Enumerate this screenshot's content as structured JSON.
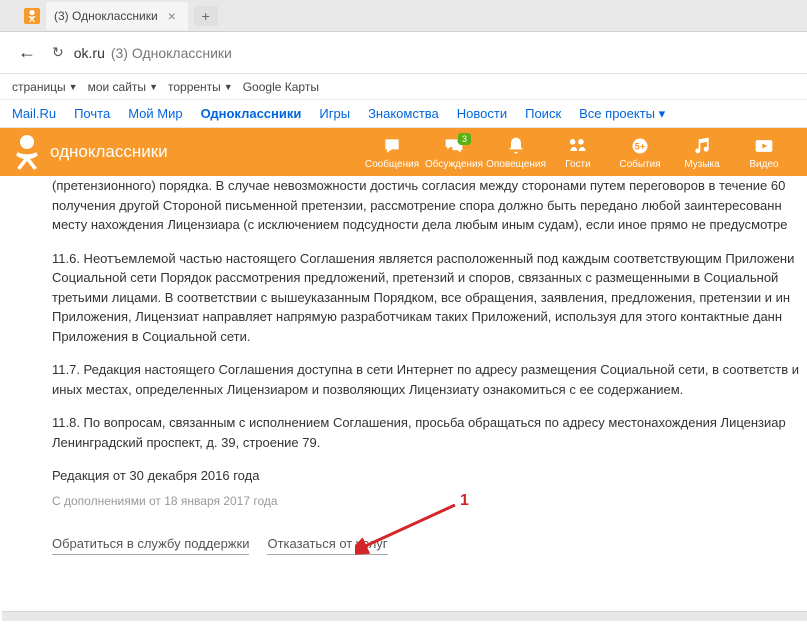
{
  "tab": {
    "title": "(3) Одноклассники"
  },
  "url": {
    "domain": "ok.ru",
    "rest": "(3) Одноклассники"
  },
  "bookmarks": [
    {
      "label": "страницы"
    },
    {
      "label": "мои сайты"
    },
    {
      "label": "торренты"
    },
    {
      "label": "Google Карты"
    }
  ],
  "mailru": {
    "items": [
      {
        "label": "Mail.Ru",
        "active": false
      },
      {
        "label": "Почта",
        "active": false
      },
      {
        "label": "Мой Мир",
        "active": false
      },
      {
        "label": "Одноклассники",
        "active": true
      },
      {
        "label": "Игры",
        "active": false
      },
      {
        "label": "Знакомства",
        "active": false
      },
      {
        "label": "Новости",
        "active": false
      },
      {
        "label": "Поиск",
        "active": false
      },
      {
        "label": "Все проекты ▾",
        "active": false
      }
    ]
  },
  "okheader": {
    "logo_text": "одноклассники",
    "nav": [
      {
        "label": "Сообщения",
        "icon": "messages"
      },
      {
        "label": "Обсуждения",
        "icon": "discussions",
        "badge": "3"
      },
      {
        "label": "Оповещения",
        "icon": "notifications"
      },
      {
        "label": "Гости",
        "icon": "guests"
      },
      {
        "label": "События",
        "icon": "events",
        "badge": "5+"
      },
      {
        "label": "Музыка",
        "icon": "music"
      },
      {
        "label": "Видео",
        "icon": "video"
      }
    ]
  },
  "content": {
    "paragraphs": [
      "(претензионного) порядка. В случае невозможности достичь согласия между сторонами путем переговоров в течение 60 получения другой Стороной письменной претензии, рассмотрение спора должно быть передано любой заинтересованн месту нахождения Лицензиара (с исключением подсудности дела любым иным судам), если иное прямо не предусмотре",
      "11.6. Неотъемлемой частью настоящего Соглашения является расположенный под каждым соответствующим Приложени Социальной сети Порядок рассмотрения предложений, претензий и споров, связанных с размещенными в Социальной третьими лицами. В соответствии с вышеуказанным Порядком, все обращения, заявления, предложения, претензии и ин Приложения, Лицензиат направляет напрямую разработчикам таких Приложений, используя для этого контактные данн Приложения в Социальной сети.",
      "11.7. Редакция настоящего Соглашения доступна в сети Интернет по адресу размещения Социальной сети, в соответств и иных местах, определенных Лицензиаром и позволяющих Лицензиату ознакомиться с ее содержанием.",
      "11.8. По вопросам, связанным с исполнением Соглашения, просьба обращаться по адресу местонахождения Лицензиар Ленинградский проспект, д. 39, строение 79."
    ],
    "date_main": "Редакция от 30 декабря 2016 года",
    "date_sub": "С дополнениями от 18 января 2017 года",
    "support_link": "Обратиться в службу поддержки",
    "refuse_link": "Отказаться от услуг"
  },
  "annot": {
    "label1": "1"
  }
}
